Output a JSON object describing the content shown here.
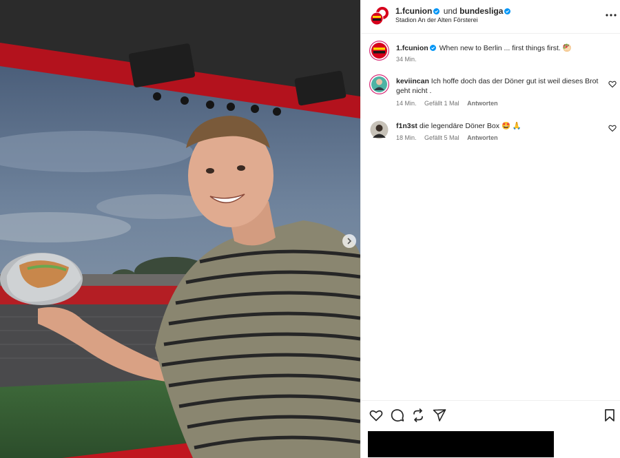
{
  "header": {
    "account": "1.fcunion",
    "joiner": "und",
    "collaborator": "bundesliga",
    "location": "Stadion An der Alten Försterei"
  },
  "comments": [
    {
      "username": "1.fcunion",
      "verified": true,
      "text": "When new to Berlin ... first things first. 🥙",
      "time": "34 Min.",
      "likes": "",
      "reply": ""
    },
    {
      "username": "keviincan",
      "verified": false,
      "text": "Ich hoffe doch das der Döner gut ist weil dieses Brot geht nicht .",
      "time": "14 Min.",
      "likes": "Gefällt 1 Mal",
      "reply": "Antworten"
    },
    {
      "username": "f1n3st",
      "verified": false,
      "text": "die legendäre Döner Box 🤩 🙏",
      "time": "18 Min.",
      "likes": "Gefällt 5 Mal",
      "reply": "Antworten"
    }
  ],
  "colors": {
    "club_red": "#d6001c",
    "club_yellow": "#ffd200",
    "verified_blue": "#0095f6",
    "meta_gray": "#737373"
  },
  "icons": [
    "heart-icon",
    "comment-icon",
    "share-icon",
    "send-icon",
    "bookmark-icon",
    "more-icon",
    "chevron-right-icon"
  ]
}
